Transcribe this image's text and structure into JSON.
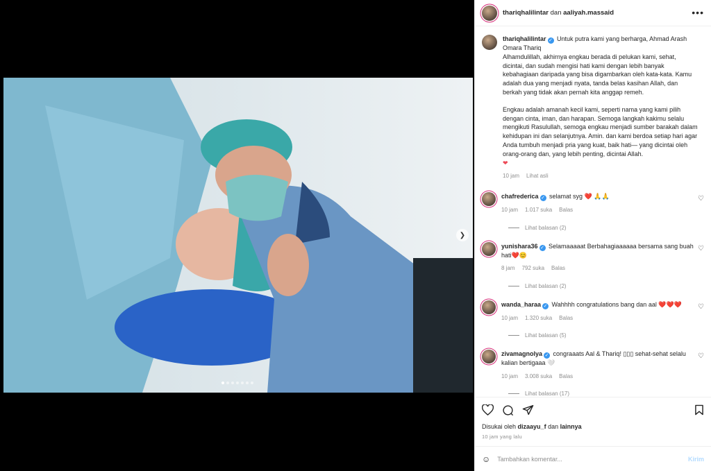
{
  "header": {
    "author": "thariqhalilintar",
    "joiner": "dan",
    "coauthor": "aaliyah.massaid",
    "more_icon": "more-horizontal-icon"
  },
  "caption": {
    "username": "thariqhalilintar",
    "line1": "Untuk putra kami yang berharga, Ahmad Arash Omara Thariq",
    "para1": "Alhamdulillah, akhirnya engkau berada di pelukan kami, sehat, dicintai, dan sudah mengisi hati kami dengan lebih banyak kebahagiaan daripada yang bisa digambarkan oleh kata-kata. Kamu adalah dua yang menjadi nyata, tanda belas kasihan Allah, dan berkah yang tidak akan pernah kita anggap remeh.",
    "para2": "Engkau adalah amanah kecil kami, seperti nama yang kami pilih dengan cinta, iman, dan harapan. Semoga langkah kakimu selalu mengikuti Rasulullah, semoga engkau menjadi sumber barakah dalam kehidupan ini dan selanjutnya. Amin. dan kami berdoa setiap hari agar Anda tumbuh menjadi pria yang kuat, baik hati— yang dicintai oleh orang-orang dan, yang lebih penting, dicintai Allah.",
    "time": "10 jam",
    "see_translation": "Lihat asli"
  },
  "comments": [
    {
      "username": "chafrederica",
      "text": "selamat syg ❤️ 🙏🙏",
      "time": "10 jam",
      "likes": "1.017 suka",
      "reply": "Balas",
      "replies": "Lihat balasan (2)"
    },
    {
      "username": "yunishara36",
      "text": "Selamaaaaat Berbahagiaaaaaa bersama sang buah hati❤️😊",
      "time": "8 jam",
      "likes": "792 suka",
      "reply": "Balas",
      "replies": "Lihat balasan (2)"
    },
    {
      "username": "wanda_haraa",
      "text": "Wahhhh congratulations bang dan aal ❤️❤️❤️",
      "time": "10 jam",
      "likes": "1.320 suka",
      "reply": "Balas",
      "replies": "Lihat balasan (5)"
    },
    {
      "username": "zivamagnolya",
      "text": "congraaats Aal & Thariq! ▯▯▯ sehat-sehat selalu kalian bertigaaa 🤍",
      "time": "10 jam",
      "likes": "3.008 suka",
      "reply": "Balas",
      "replies": "Lihat balasan (17)"
    }
  ],
  "likes": {
    "prefix": "Disukai oleh",
    "user": "dizaayu_f",
    "joiner": "dan",
    "others": "lainnya"
  },
  "time_ago": "10 jam yang lalu",
  "add_comment": {
    "placeholder": "Tambahkan komentar...",
    "post": "Kirim"
  },
  "carousel": {
    "count": 7,
    "active": 0
  },
  "icons": {
    "like": "heart-icon",
    "comment": "comment-icon",
    "share": "share-icon",
    "save": "bookmark-icon",
    "emoji": "emoji-icon",
    "next": "chevron-right-icon",
    "verified": "verified-badge-icon"
  },
  "colors": {
    "verified": "#3897f0",
    "heart_red": "#ed4956",
    "muted_text": "#8e8e8e",
    "post_button": "#b3dbff"
  }
}
